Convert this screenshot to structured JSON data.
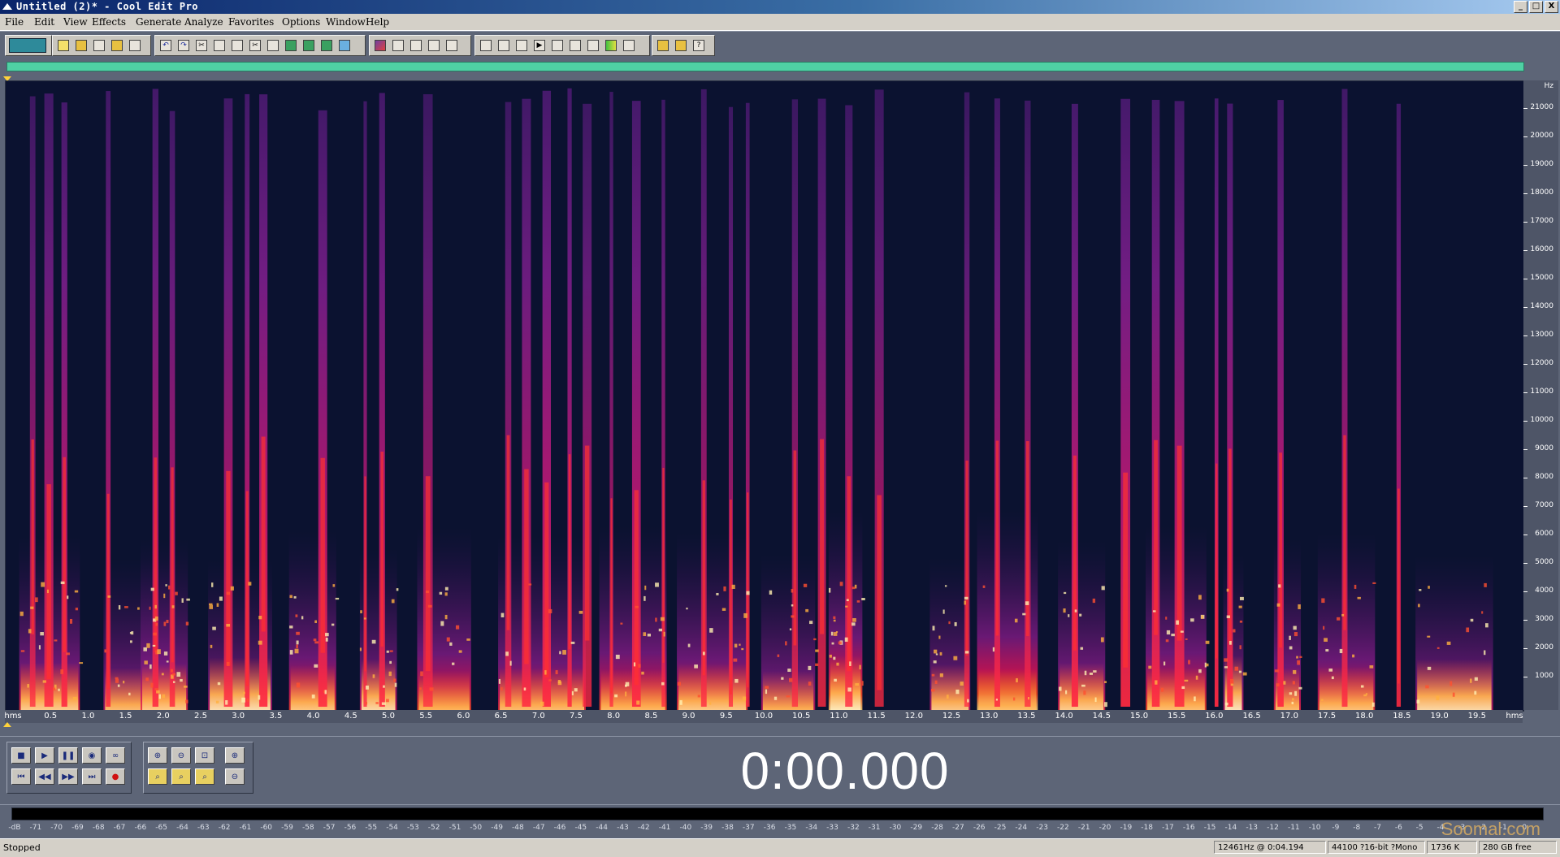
{
  "window": {
    "title": "Untitled (2)* - Cool Edit Pro",
    "buttons": [
      "_",
      "□",
      "X"
    ]
  },
  "menu": [
    "File",
    "Edit",
    "View",
    "Effects",
    "Generate",
    "Analyze",
    "Favorites",
    "Options",
    "Window",
    "Help"
  ],
  "spectral_view": {
    "frequency_unit": "Hz",
    "frequency_labels": [
      "21000",
      "20000",
      "19000",
      "18000",
      "17000",
      "16000",
      "15000",
      "14000",
      "13000",
      "12000",
      "11000",
      "10000",
      "9000",
      "8000",
      "7000",
      "6000",
      "5000",
      "4000",
      "3000",
      "2000",
      "1000"
    ],
    "time_labels": [
      "hms",
      "0.5",
      "1.0",
      "1.5",
      "2.0",
      "2.5",
      "3.0",
      "3.5",
      "4.0",
      "4.5",
      "5.0",
      "5.5",
      "6.0",
      "6.5",
      "7.0",
      "7.5",
      "8.0",
      "8.5",
      "9.0",
      "9.5",
      "10.0",
      "10.5",
      "11.0",
      "11.5",
      "12.0",
      "12.5",
      "13.0",
      "13.5",
      "14.0",
      "14.5",
      "15.0",
      "15.5",
      "16.0",
      "16.5",
      "17.0",
      "17.5",
      "18.0",
      "18.5",
      "19.0",
      "19.5",
      "hms"
    ],
    "colors": {
      "background": "#0b1230",
      "low": "#5a1a7a",
      "mid": "#d4145a",
      "high": "#ff4a20",
      "peak": "#ffe9a0"
    }
  },
  "transport": {
    "time_display": "0:00.000"
  },
  "level_meter": {
    "labels": [
      "-dB",
      "-71",
      "-70",
      "-69",
      "-68",
      "-67",
      "-66",
      "-65",
      "-64",
      "-63",
      "-62",
      "-61",
      "-60",
      "-59",
      "-58",
      "-57",
      "-56",
      "-55",
      "-54",
      "-53",
      "-52",
      "-51",
      "-50",
      "-49",
      "-48",
      "-47",
      "-46",
      "-45",
      "-44",
      "-43",
      "-42",
      "-41",
      "-40",
      "-39",
      "-38",
      "-37",
      "-36",
      "-35",
      "-34",
      "-33",
      "-32",
      "-31",
      "-30",
      "-29",
      "-28",
      "-27",
      "-26",
      "-25",
      "-24",
      "-23",
      "-22",
      "-21",
      "-20",
      "-19",
      "-18",
      "-17",
      "-16",
      "-15",
      "-14",
      "-13",
      "-12",
      "-11",
      "-10",
      "-9",
      "-8",
      "-7",
      "-6",
      "-5",
      "-4",
      "-3",
      "-2",
      "-1",
      "0"
    ]
  },
  "watermark": "Soomal.com",
  "status": {
    "state": "Stopped",
    "cursor_info": "12461Hz @   0:04.194",
    "format": "44100 ?16-bit ?Mono",
    "size": "1736 K",
    "free": "280 GB free"
  }
}
